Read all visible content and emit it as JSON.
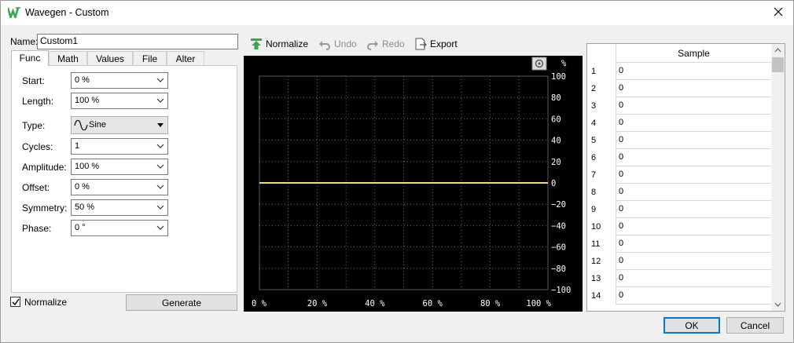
{
  "window": {
    "title": "Wavegen - Custom"
  },
  "name_field": {
    "label": "Name:",
    "value": "Custom1"
  },
  "tabs": [
    "Func",
    "Math",
    "Values",
    "File",
    "Alter"
  ],
  "form": {
    "start": {
      "label": "Start:",
      "value": "0 %"
    },
    "length": {
      "label": "Length:",
      "value": "100 %"
    },
    "type": {
      "label": "Type:",
      "value": "Sine",
      "icon": "sine-wave-icon"
    },
    "cycles": {
      "label": "Cycles:",
      "value": "1"
    },
    "amplitude": {
      "label": "Amplitude:",
      "value": "100 %"
    },
    "offset": {
      "label": "Offset:",
      "value": "0 %"
    },
    "symmetry": {
      "label": "Symmetry:",
      "value": "50 %"
    },
    "phase": {
      "label": "Phase:",
      "value": "0 °"
    }
  },
  "normalize_checkbox": {
    "label": "Normalize",
    "checked": true
  },
  "generate_button": "Generate",
  "toolbar": {
    "normalize": "Normalize",
    "undo": "Undo",
    "redo": "Redo",
    "export": "Export"
  },
  "plot": {
    "y_unit": "%",
    "y_ticks": [
      "100",
      "80",
      "60",
      "40",
      "20",
      "0",
      "−20",
      "−40",
      "−60",
      "−80",
      "−100"
    ],
    "x_ticks": [
      "0 %",
      "20 %",
      "40 %",
      "60 %",
      "80 %",
      "100 %"
    ],
    "trace_value": 0,
    "trace_color": "#f2e35c",
    "background": "#000000"
  },
  "sample_table": {
    "header": "Sample",
    "rows": [
      {
        "n": "1",
        "v": "0"
      },
      {
        "n": "2",
        "v": "0"
      },
      {
        "n": "3",
        "v": "0"
      },
      {
        "n": "4",
        "v": "0"
      },
      {
        "n": "5",
        "v": "0"
      },
      {
        "n": "6",
        "v": "0"
      },
      {
        "n": "7",
        "v": "0"
      },
      {
        "n": "8",
        "v": "0"
      },
      {
        "n": "9",
        "v": "0"
      },
      {
        "n": "10",
        "v": "0"
      },
      {
        "n": "11",
        "v": "0"
      },
      {
        "n": "12",
        "v": "0"
      },
      {
        "n": "13",
        "v": "0"
      },
      {
        "n": "14",
        "v": "0"
      }
    ]
  },
  "dialog_buttons": {
    "ok": "OK",
    "cancel": "Cancel"
  },
  "colors": {
    "accent": "#0078d7",
    "logo_green": "#3aa84a"
  }
}
